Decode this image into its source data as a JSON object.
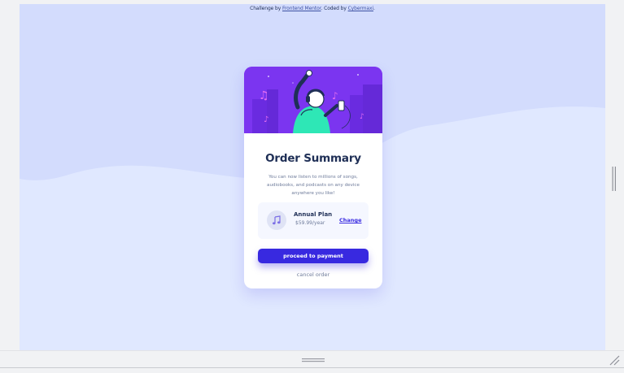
{
  "attribution": {
    "prefix": "Challenge by ",
    "link1": "Frontend Mentor",
    "middle": ". Coded by ",
    "link2": "Cybermaxi",
    "suffix": "."
  },
  "card": {
    "title": "Order Summary",
    "description": "You can now listen to millions of songs, audiobooks, and podcasts on any device anywhere you like!",
    "plan": {
      "name": "Annual Plan",
      "price": "$59.99/year",
      "change_label": "Change",
      "icon": "music-note-icon"
    },
    "pay_label": "proceed to payment",
    "cancel_label": "cancel order"
  },
  "colors": {
    "background": "#e0e8ff",
    "wave": "#d3dcfd",
    "hero": "#7b35f0",
    "accent": "#382ae1",
    "title": "#1f2f56",
    "muted": "#6f7c9b",
    "plan_box": "#f5f7ff"
  },
  "icons": [
    "music-note-icon",
    "drag-handle-icon",
    "resize-grip-icon",
    "side-handle-icon"
  ]
}
